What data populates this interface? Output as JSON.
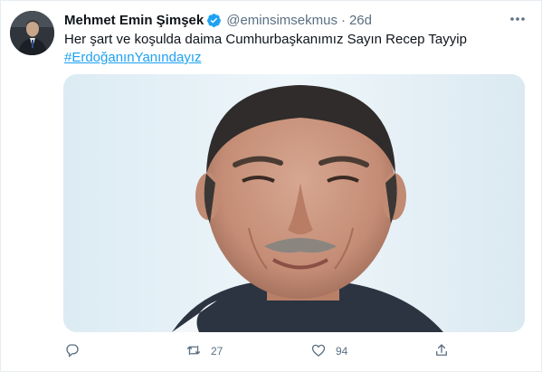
{
  "tweet": {
    "author_name": "Mehmet Emin Şimşek",
    "handle": "@eminsimsekmus",
    "separator": "·",
    "time": "26d",
    "text": "Her şart ve koşulda daima Cumhurbaşkanımız Sayın Recep Tayyip",
    "hashtag": "#ErdoğanınYanındayız",
    "media_description": "portrait photo of a smiling man",
    "verified_icon": "verified-badge-icon",
    "more_icon": "more-options-icon"
  },
  "actions": {
    "reply_icon": "reply-icon",
    "reply_count": "",
    "retweet_icon": "retweet-icon",
    "retweet_count": "27",
    "like_icon": "heart-icon",
    "like_count": "94",
    "share_icon": "share-icon"
  },
  "colors": {
    "accent": "#1da1f2",
    "text": "#0f1419",
    "secondary": "#5b7083",
    "border": "#e6ecf0"
  }
}
